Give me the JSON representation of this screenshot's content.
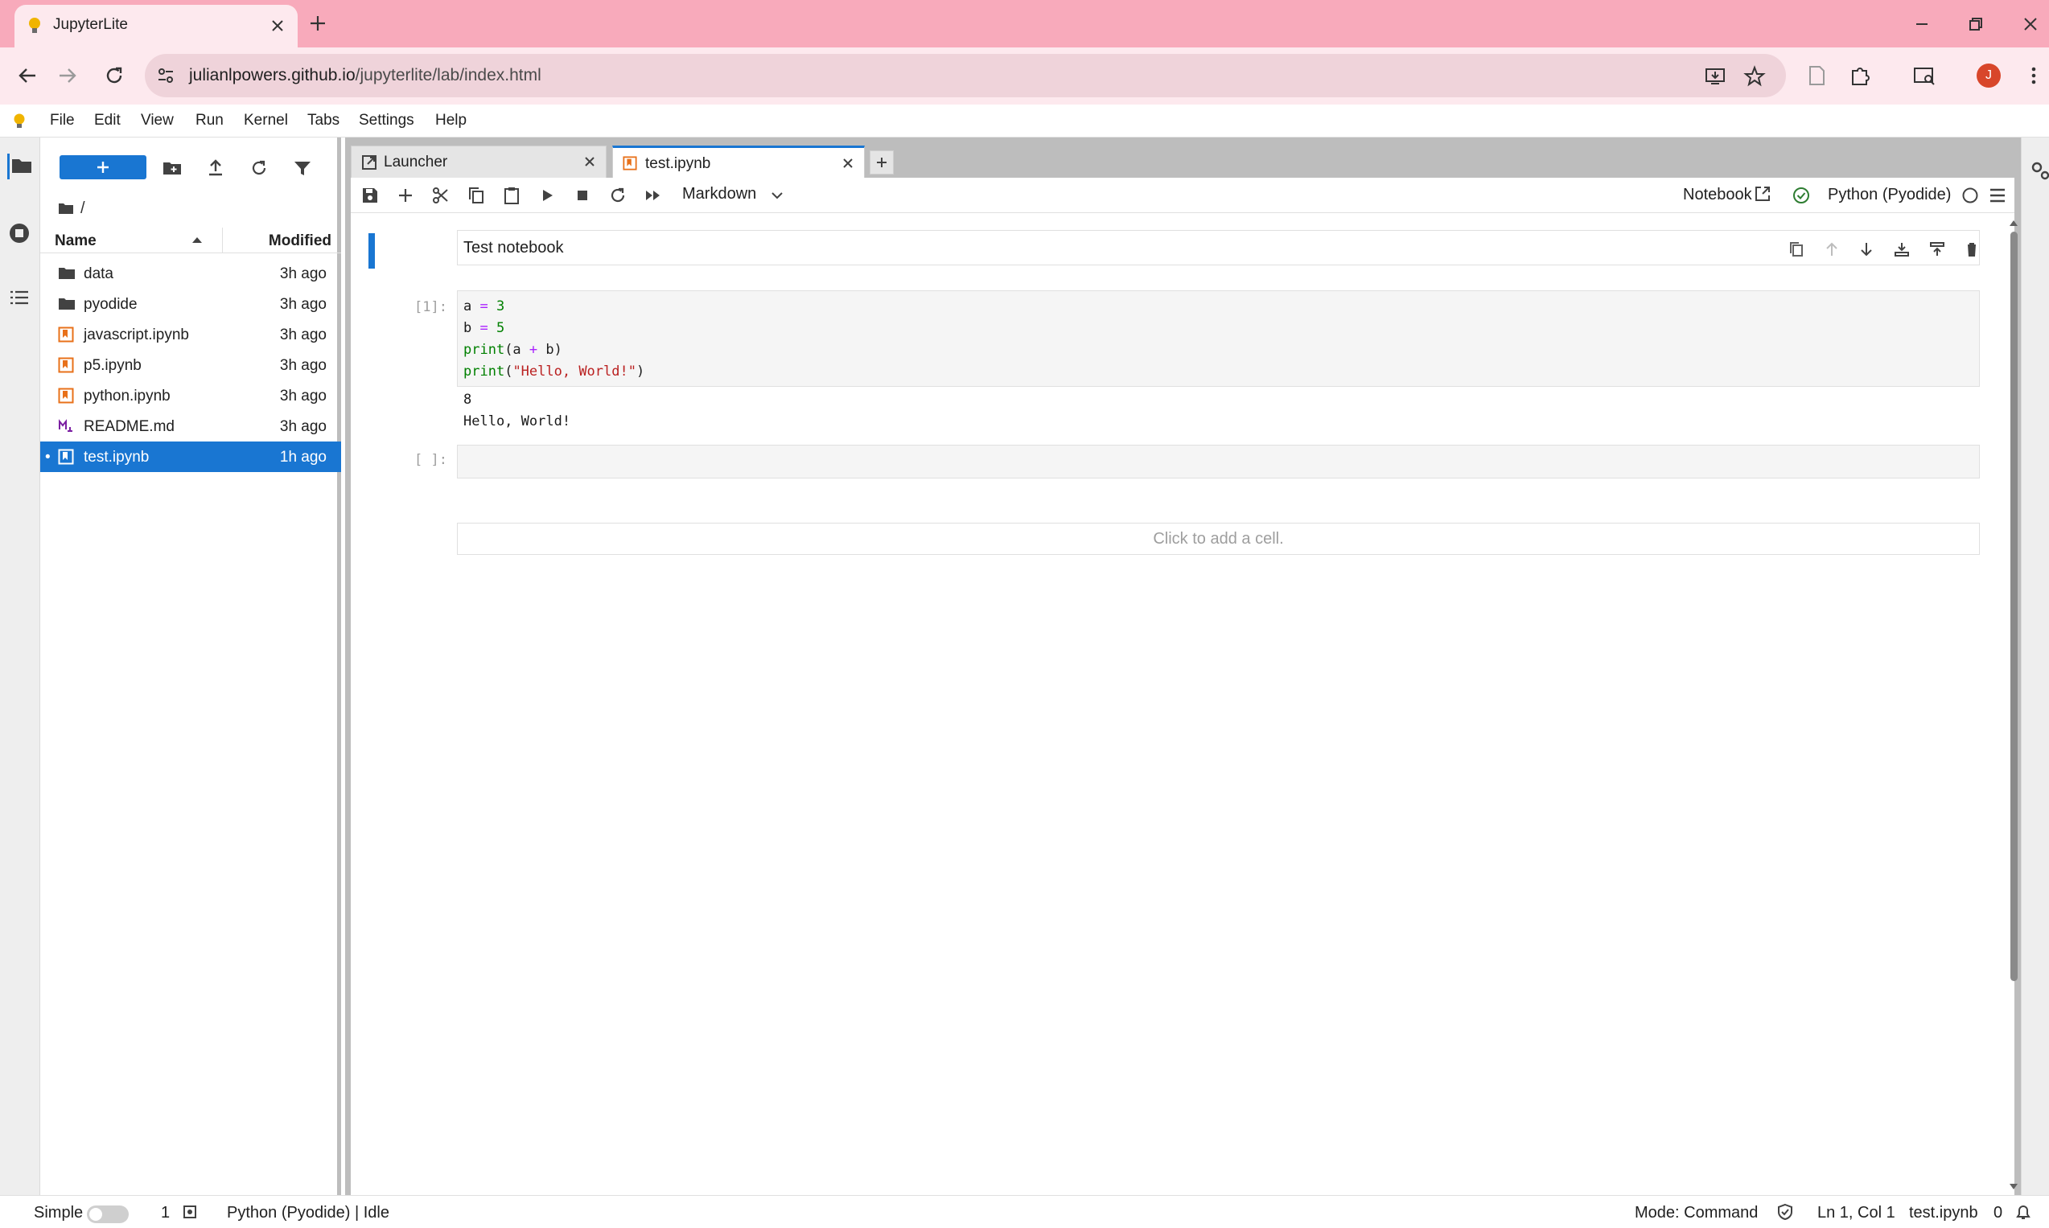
{
  "browser": {
    "tab_title": "JupyterLite",
    "url_host": "julianlpowers.github.io",
    "url_path": "/jupyterlite/lab/index.html",
    "profile_initial": "J"
  },
  "menubar": {
    "items": [
      "File",
      "Edit",
      "View",
      "Run",
      "Kernel",
      "Tabs",
      "Settings",
      "Help"
    ]
  },
  "filebrowser": {
    "path": "/",
    "col_name": "Name",
    "col_modified": "Modified",
    "files": [
      {
        "name": "data",
        "modified": "3h ago",
        "type": "folder"
      },
      {
        "name": "pyodide",
        "modified": "3h ago",
        "type": "folder"
      },
      {
        "name": "javascript.ipynb",
        "modified": "3h ago",
        "type": "notebook"
      },
      {
        "name": "p5.ipynb",
        "modified": "3h ago",
        "type": "notebook"
      },
      {
        "name": "python.ipynb",
        "modified": "3h ago",
        "type": "notebook"
      },
      {
        "name": "README.md",
        "modified": "3h ago",
        "type": "markdown"
      },
      {
        "name": "test.ipynb",
        "modified": "1h ago",
        "type": "notebook",
        "selected": true
      }
    ]
  },
  "doc_tabs": [
    {
      "label": "Launcher",
      "icon": "launcher-icon"
    },
    {
      "label": "test.ipynb",
      "icon": "notebook-icon",
      "active": true
    }
  ],
  "notebook": {
    "cell_type": "Markdown",
    "mode_label": "Notebook",
    "kernel": "Python (Pyodide)",
    "cells": {
      "markdown_text": "Test notebook",
      "code_prompt": "[1]:",
      "code_lines": [
        "a = 3",
        "b = 5",
        "print(a + b)",
        "print(\"Hello, World!\")"
      ],
      "output_lines": [
        "8",
        "Hello, World!"
      ],
      "empty_prompt": "[ ]:"
    },
    "add_cell_hint": "Click to add a cell."
  },
  "statusbar": {
    "simple_label": "Simple",
    "terminals": "1",
    "kernel_status": "Python (Pyodide) | Idle",
    "mode": "Mode: Command",
    "cursor": "Ln 1, Col 1",
    "file": "test.ipynb",
    "notifications": "0"
  },
  "colors": {
    "accent": "#1976d2",
    "browser_frame": "#f8aabb",
    "notebook_orange": "#e8711a"
  }
}
